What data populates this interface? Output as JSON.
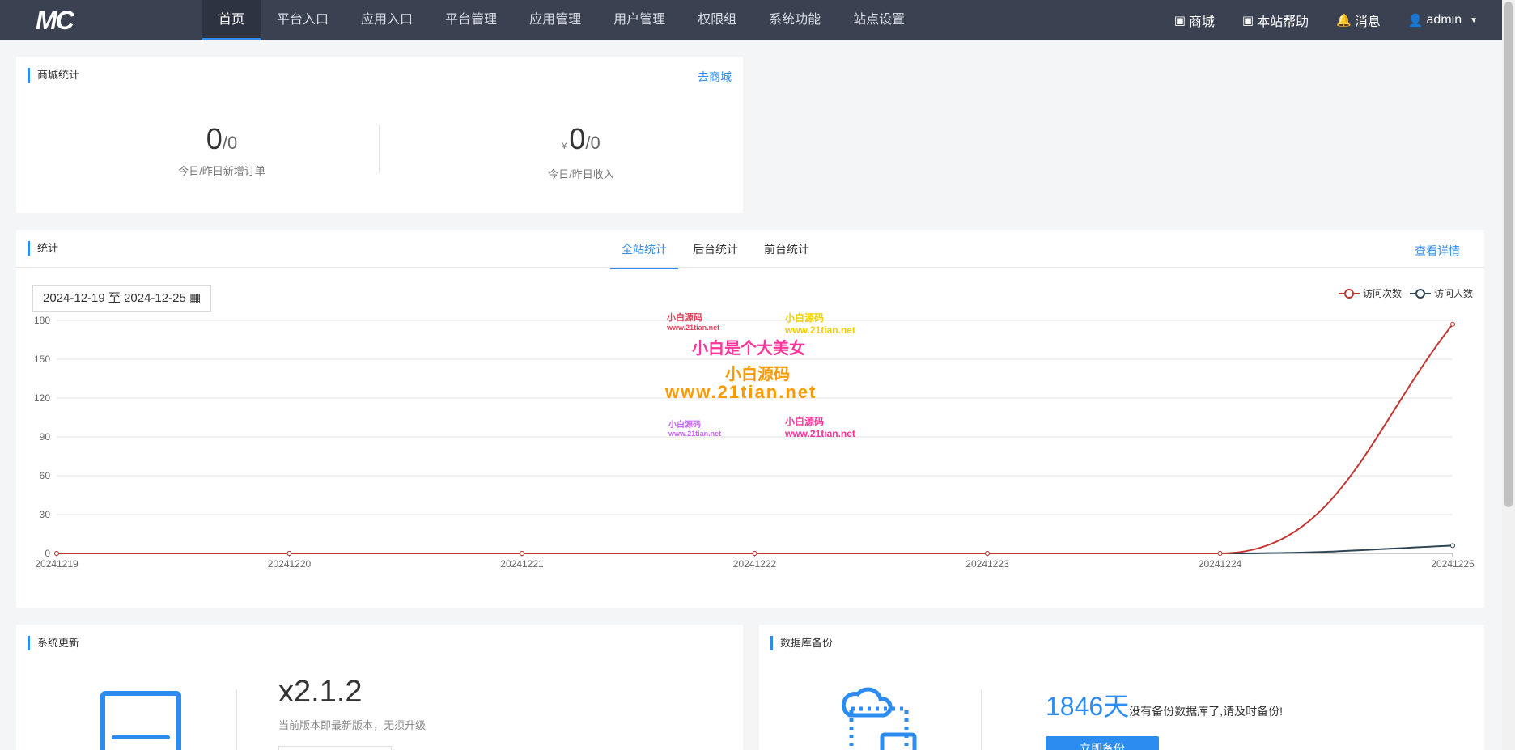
{
  "logo": {
    "text": "MC"
  },
  "nav": {
    "tabs": [
      "首页",
      "平台入口",
      "应用入口",
      "平台管理",
      "应用管理",
      "用户管理",
      "权限组",
      "系统功能",
      "站点设置"
    ],
    "active": 0,
    "right": {
      "shop": "商城",
      "help": "本站帮助",
      "messages": "消息",
      "user": "admin"
    }
  },
  "shop_panel": {
    "title": "商城统计",
    "link": "去商城",
    "orders": {
      "today": "0",
      "yesterday": "/0",
      "label": "今日/昨日新增订单"
    },
    "income": {
      "currency": "¥",
      "today": "0",
      "yesterday": "/0",
      "label": "今日/昨日收入"
    }
  },
  "stats_panel": {
    "title": "统计",
    "tabs": [
      "全站统计",
      "后台统计",
      "前台统计"
    ],
    "active_tab": 0,
    "link": "查看详情",
    "date_range": "2024-12-19 至 2024-12-25",
    "legend": [
      "访问次数",
      "访问人数"
    ]
  },
  "chart_data": {
    "type": "line",
    "categories": [
      "20241219",
      "20241220",
      "20241221",
      "20241222",
      "20241223",
      "20241224",
      "20241225"
    ],
    "y_ticks": [
      0,
      30,
      60,
      90,
      120,
      150,
      180
    ],
    "ylim": [
      0,
      180
    ],
    "series": [
      {
        "name": "访问次数",
        "color": "#c23531",
        "values": [
          0,
          0,
          0,
          0,
          0,
          0,
          177
        ]
      },
      {
        "name": "访问人数",
        "color": "#2f4554",
        "values": [
          0,
          0,
          0,
          0,
          0,
          0,
          6
        ]
      }
    ],
    "grid": true,
    "legend_position": "top-right"
  },
  "watermarks": {
    "w1": "小白源码",
    "w2": "www.21tian.net",
    "w3": "小白是个大美女",
    "w4": "小白源码",
    "w5": "www.21tian.net"
  },
  "update_panel": {
    "title": "系统更新",
    "version": "x2.1.2",
    "note": "当前版本即最新版本，无须升级"
  },
  "db_panel": {
    "title": "数据库备份",
    "days": "1846天",
    "note": "没有备份数据库了,请及时备份!",
    "button": "立即备份"
  },
  "colors": {
    "accent": "#2d8cf0",
    "topbar": "#3a4150"
  },
  "icons": {
    "shop": "store-icon",
    "help": "help-icon",
    "messages": "bell-icon",
    "user": "user-icon",
    "calendar": "calendar-icon"
  }
}
